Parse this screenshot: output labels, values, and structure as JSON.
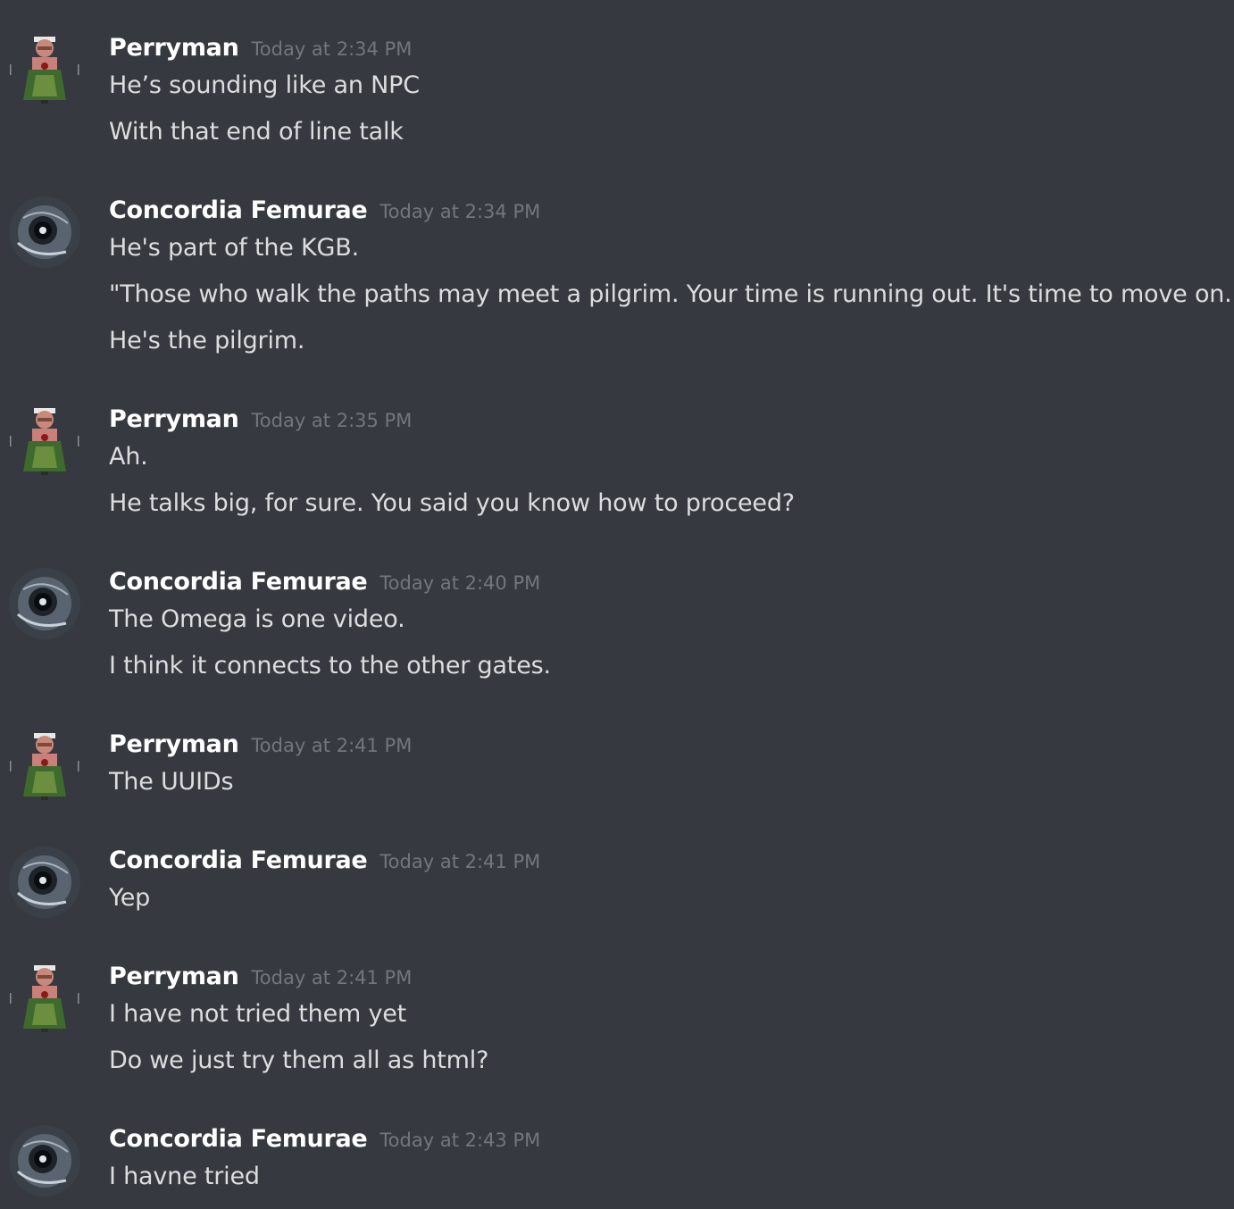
{
  "theme": {
    "background": "#36393f",
    "username_color": "#ffffff",
    "timestamp_color": "#72767d",
    "text_color": "#dcddde"
  },
  "messages": [
    {
      "author": "Perryman",
      "avatar_icon": "perryman-avatar-icon",
      "timestamp": "Today at 2:34 PM",
      "lines": [
        "He’s sounding like an NPC",
        "With that end of line talk"
      ]
    },
    {
      "author": "Concordia Femurae",
      "avatar_icon": "blackhole-avatar-icon",
      "timestamp": "Today at 2:34 PM",
      "lines": [
        "He's part of the KGB.",
        "\"Those who walk the paths may meet a pilgrim. Your time is running out. It's time to move on.\"",
        "He's the pilgrim."
      ]
    },
    {
      "author": "Perryman",
      "avatar_icon": "perryman-avatar-icon",
      "timestamp": "Today at 2:35 PM",
      "lines": [
        "Ah.",
        "He talks big, for sure. You said you know how to proceed?"
      ]
    },
    {
      "author": "Concordia Femurae",
      "avatar_icon": "blackhole-avatar-icon",
      "timestamp": "Today at 2:40 PM",
      "lines": [
        "The Omega is one video.",
        "I think it connects to the other gates."
      ]
    },
    {
      "author": "Perryman",
      "avatar_icon": "perryman-avatar-icon",
      "timestamp": "Today at 2:41 PM",
      "lines": [
        "The UUIDs"
      ]
    },
    {
      "author": "Concordia Femurae",
      "avatar_icon": "blackhole-avatar-icon",
      "timestamp": "Today at 2:41 PM",
      "lines": [
        "Yep"
      ]
    },
    {
      "author": "Perryman",
      "avatar_icon": "perryman-avatar-icon",
      "timestamp": "Today at 2:41 PM",
      "lines": [
        "I have not tried them yet",
        "Do we just try them all as html?"
      ]
    },
    {
      "author": "Concordia Femurae",
      "avatar_icon": "blackhole-avatar-icon",
      "timestamp": "Today at 2:43 PM",
      "lines": [
        "I havne tried"
      ]
    }
  ]
}
